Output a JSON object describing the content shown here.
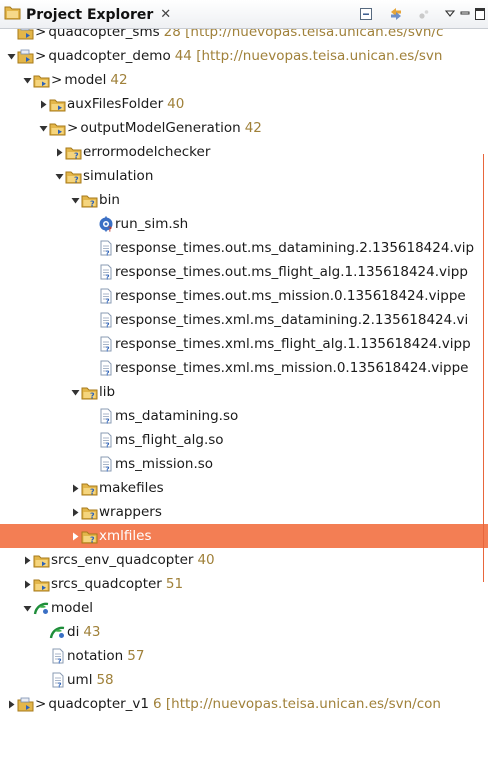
{
  "panel": {
    "title": "Project Explorer",
    "close_glyph": "✕"
  },
  "toolbar": [
    "collapse-all-icon",
    "link-with-editor-icon",
    "filter-icon",
    "view-menu-icon",
    "minimize-icon",
    "maximize-icon"
  ],
  "colors": {
    "selection": "#f37e54",
    "count": "#a0813a",
    "folder": "#e3b64a"
  },
  "tree": [
    {
      "name": "project-quadcopter-sms",
      "indent": 0,
      "twisty": "none",
      "icon": "project",
      "dec": "> ",
      "label": "quadcopter_sms",
      "count": "28 [http://nuevopas.teisa.unican.es/svn/c"
    },
    {
      "name": "project-quadcopter-demo",
      "indent": 0,
      "twisty": "open",
      "icon": "project",
      "dec": "> ",
      "label": "quadcopter_demo",
      "count": "44 [http://nuevopas.teisa.unican.es/svn"
    },
    {
      "name": "folder-model",
      "indent": 1,
      "twisty": "open",
      "icon": "folder",
      "dec": "> ",
      "label": "model",
      "count": "42"
    },
    {
      "name": "folder-auxfilesfolder",
      "indent": 2,
      "twisty": "closed",
      "icon": "folder",
      "dec": "",
      "label": "auxFilesFolder",
      "count": "40"
    },
    {
      "name": "folder-outputmodelgeneration",
      "indent": 2,
      "twisty": "open",
      "icon": "folder",
      "dec": "> ",
      "label": "outputModelGeneration",
      "count": "42"
    },
    {
      "name": "folder-errormodelchecker",
      "indent": 3,
      "twisty": "closed",
      "icon": "folder-q",
      "dec": "",
      "label": "errormodelchecker",
      "count": ""
    },
    {
      "name": "folder-simulation",
      "indent": 3,
      "twisty": "open",
      "icon": "folder-q",
      "dec": "",
      "label": "simulation",
      "count": ""
    },
    {
      "name": "folder-bin",
      "indent": 4,
      "twisty": "open",
      "icon": "folder-q",
      "dec": "",
      "label": "bin",
      "count": ""
    },
    {
      "name": "file-run-sim-sh",
      "indent": 5,
      "twisty": "none",
      "icon": "script",
      "dec": "",
      "label": "run_sim.sh",
      "count": ""
    },
    {
      "name": "file-response-times-out-datamining",
      "indent": 5,
      "twisty": "none",
      "icon": "file",
      "dec": "",
      "label": "response_times.out.ms_datamining.2.135618424.vip",
      "count": ""
    },
    {
      "name": "file-response-times-out-flight-alg",
      "indent": 5,
      "twisty": "none",
      "icon": "file",
      "dec": "",
      "label": "response_times.out.ms_flight_alg.1.135618424.vipp",
      "count": ""
    },
    {
      "name": "file-response-times-out-mission",
      "indent": 5,
      "twisty": "none",
      "icon": "file",
      "dec": "",
      "label": "response_times.out.ms_mission.0.135618424.vippe",
      "count": ""
    },
    {
      "name": "file-response-times-xml-datamining",
      "indent": 5,
      "twisty": "none",
      "icon": "file",
      "dec": "",
      "label": "response_times.xml.ms_datamining.2.135618424.vi",
      "count": ""
    },
    {
      "name": "file-response-times-xml-flight-alg",
      "indent": 5,
      "twisty": "none",
      "icon": "file",
      "dec": "",
      "label": "response_times.xml.ms_flight_alg.1.135618424.vipp",
      "count": ""
    },
    {
      "name": "file-response-times-xml-mission",
      "indent": 5,
      "twisty": "none",
      "icon": "file",
      "dec": "",
      "label": "response_times.xml.ms_mission.0.135618424.vippe",
      "count": ""
    },
    {
      "name": "folder-lib",
      "indent": 4,
      "twisty": "open",
      "icon": "folder-q",
      "dec": "",
      "label": "lib",
      "count": ""
    },
    {
      "name": "file-ms-datamining-so",
      "indent": 5,
      "twisty": "none",
      "icon": "file",
      "dec": "",
      "label": "ms_datamining.so",
      "count": ""
    },
    {
      "name": "file-ms-flight-alg-so",
      "indent": 5,
      "twisty": "none",
      "icon": "file",
      "dec": "",
      "label": "ms_flight_alg.so",
      "count": ""
    },
    {
      "name": "file-ms-mission-so",
      "indent": 5,
      "twisty": "none",
      "icon": "file",
      "dec": "",
      "label": "ms_mission.so",
      "count": ""
    },
    {
      "name": "folder-makefiles",
      "indent": 4,
      "twisty": "closed",
      "icon": "folder-q",
      "dec": "",
      "label": "makefiles",
      "count": ""
    },
    {
      "name": "folder-wrappers",
      "indent": 4,
      "twisty": "closed",
      "icon": "folder-q",
      "dec": "",
      "label": "wrappers",
      "count": ""
    },
    {
      "name": "folder-xmlfiles",
      "indent": 4,
      "twisty": "closed",
      "icon": "folder-q",
      "dec": "",
      "label": "xmlfiles",
      "count": "",
      "selected": true
    },
    {
      "name": "folder-srcs-env-quadcopter",
      "indent": 1,
      "twisty": "closed",
      "icon": "folder",
      "dec": "",
      "label": "srcs_env_quadcopter",
      "count": "40"
    },
    {
      "name": "folder-srcs-quadcopter",
      "indent": 1,
      "twisty": "closed",
      "icon": "folder",
      "dec": "",
      "label": "srcs_quadcopter",
      "count": "51"
    },
    {
      "name": "model-papyrus",
      "indent": 1,
      "twisty": "open",
      "icon": "papyrus",
      "dec": "",
      "label": "model",
      "count": ""
    },
    {
      "name": "file-di",
      "indent": 2,
      "twisty": "none",
      "icon": "papyrus",
      "dec": "",
      "label": "di",
      "count": "43"
    },
    {
      "name": "file-notation",
      "indent": 2,
      "twisty": "none",
      "icon": "file",
      "dec": "",
      "label": "notation",
      "count": "57"
    },
    {
      "name": "file-uml",
      "indent": 2,
      "twisty": "none",
      "icon": "file",
      "dec": "",
      "label": "uml",
      "count": "58"
    },
    {
      "name": "project-quadcopter-v1",
      "indent": 0,
      "twisty": "closed",
      "icon": "project",
      "dec": "> ",
      "label": "quadcopter_v1",
      "count": "6 [http://nuevopas.teisa.unican.es/svn/con"
    }
  ]
}
